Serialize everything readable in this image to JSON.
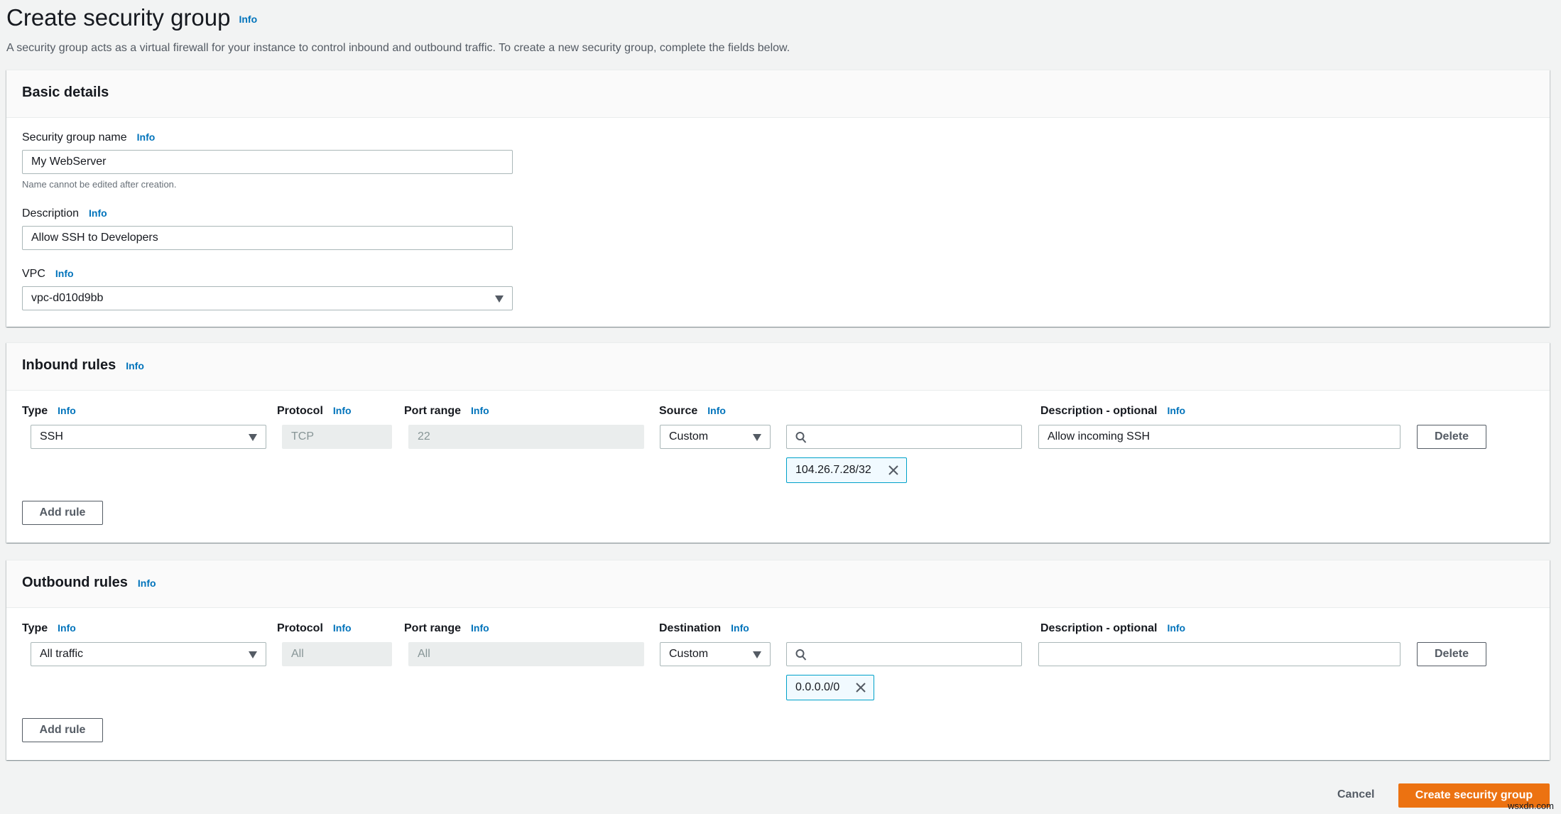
{
  "page": {
    "title": "Create security group",
    "title_info": "Info",
    "description": "A security group acts as a virtual firewall for your instance to control inbound and outbound traffic. To create a new security group, complete the fields below."
  },
  "basic_details": {
    "heading": "Basic details",
    "name_label": "Security group name",
    "name_info": "Info",
    "name_value": "My WebServer",
    "name_hint": "Name cannot be edited after creation.",
    "description_label": "Description",
    "description_info": "Info",
    "description_value": "Allow SSH to Developers",
    "vpc_label": "VPC",
    "vpc_info": "Info",
    "vpc_value": "vpc-d010d9bb"
  },
  "inbound": {
    "heading": "Inbound rules",
    "heading_info": "Info",
    "columns": {
      "type": "Type",
      "protocol": "Protocol",
      "port_range": "Port range",
      "source": "Source",
      "description": "Description - optional",
      "info": "Info"
    },
    "rules": [
      {
        "type": "SSH",
        "protocol": "TCP",
        "port_range": "22",
        "source_mode": "Custom",
        "search_value": "",
        "cidr_tokens": [
          "104.26.7.28/32"
        ],
        "description": "Allow incoming SSH",
        "delete_label": "Delete"
      }
    ],
    "add_rule_label": "Add rule"
  },
  "outbound": {
    "heading": "Outbound rules",
    "heading_info": "Info",
    "columns": {
      "type": "Type",
      "protocol": "Protocol",
      "port_range": "Port range",
      "destination": "Destination",
      "description": "Description - optional",
      "info": "Info"
    },
    "rules": [
      {
        "type": "All traffic",
        "protocol": "All",
        "port_range": "All",
        "destination_mode": "Custom",
        "search_value": "",
        "cidr_tokens": [
          "0.0.0.0/0"
        ],
        "description": "",
        "delete_label": "Delete"
      }
    ],
    "add_rule_label": "Add rule"
  },
  "footer": {
    "cancel_label": "Cancel",
    "create_label": "Create security group"
  },
  "watermark": "wsxdn.com",
  "colors": {
    "accent_link": "#0073bb",
    "primary_button": "#ec7211",
    "token_border": "#00a1c9",
    "token_bg": "#f1faff"
  }
}
